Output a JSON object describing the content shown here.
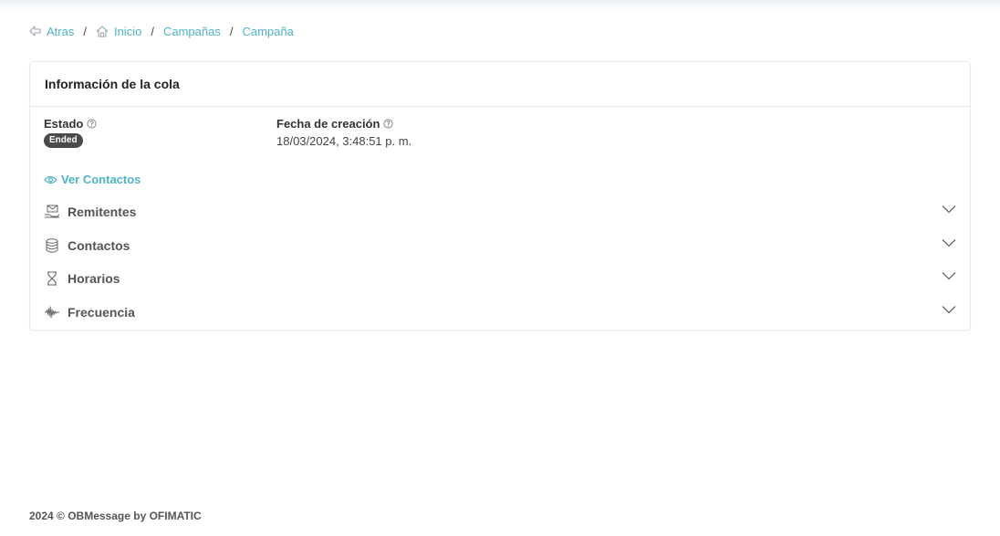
{
  "breadcrumb": {
    "back": "Atras",
    "home": "Inicio",
    "campaigns": "Campañas",
    "campaign": "Campaña",
    "separator": "/"
  },
  "card": {
    "title": "Información de la cola",
    "status_label": "Estado",
    "status_value": "Ended",
    "created_label": "Fecha de creación",
    "created_value": "18/03/2024, 3:48:51 p. m.",
    "view_contacts": "Ver Contactos",
    "sections": [
      {
        "label": "Remitentes",
        "icon": "sender-icon"
      },
      {
        "label": "Contactos",
        "icon": "database-icon"
      },
      {
        "label": "Horarios",
        "icon": "hourglass-icon"
      },
      {
        "label": "Frecuencia",
        "icon": "waveform-icon"
      }
    ]
  },
  "footer": {
    "text": "2024 © OBMessage by OFIMATIC"
  },
  "colors": {
    "accent": "#4fb3c4",
    "badge_bg": "#4a4a4a"
  }
}
